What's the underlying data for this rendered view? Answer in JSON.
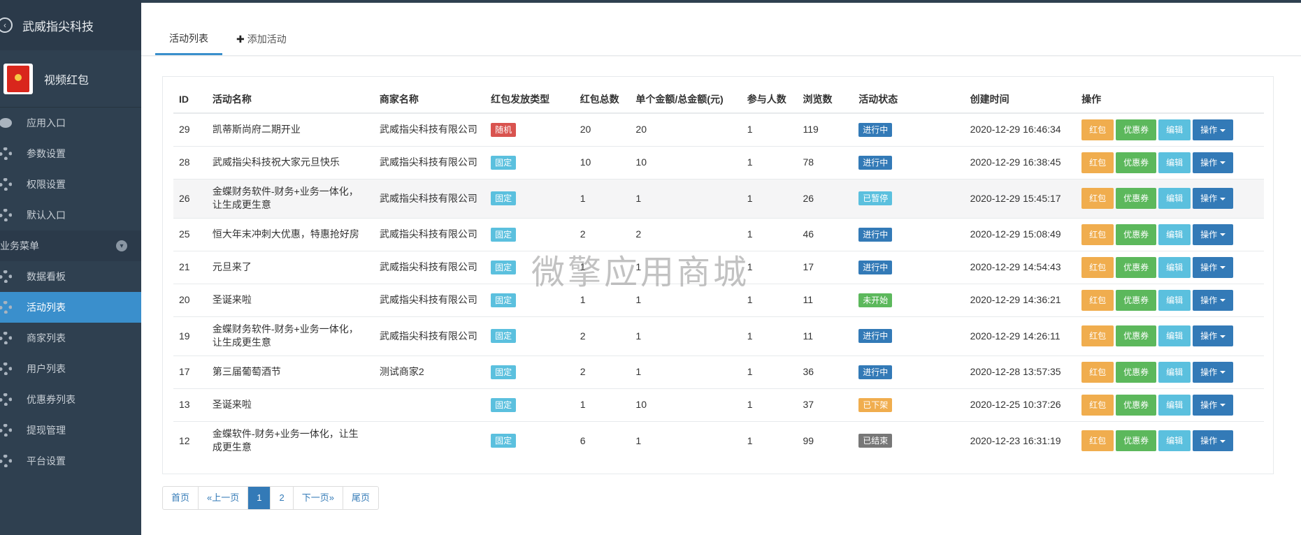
{
  "sidebar": {
    "company": "武威指尖科技",
    "app_name": "视频红包",
    "items_top": [
      {
        "label": "应用入口",
        "icon": "chat-icon"
      },
      {
        "label": "参数设置",
        "icon": "gear-icon"
      },
      {
        "label": "权限设置",
        "icon": "gear-icon"
      },
      {
        "label": "默认入口",
        "icon": "gear-icon"
      }
    ],
    "section_label": "业务菜单",
    "items": [
      {
        "label": "数据看板",
        "icon": "gear-icon",
        "active": false
      },
      {
        "label": "活动列表",
        "icon": "gear-icon",
        "active": true
      },
      {
        "label": "商家列表",
        "icon": "gear-icon",
        "active": false
      },
      {
        "label": "用户列表",
        "icon": "gear-icon",
        "active": false
      },
      {
        "label": "优惠券列表",
        "icon": "gear-icon",
        "active": false
      },
      {
        "label": "提现管理",
        "icon": "gear-icon",
        "active": false
      },
      {
        "label": "平台设置",
        "icon": "gear-icon",
        "active": false
      }
    ]
  },
  "tabs": {
    "list": "活动列表",
    "add": "添加活动"
  },
  "table": {
    "headers": [
      "ID",
      "活动名称",
      "商家名称",
      "红包发放类型",
      "红包总数",
      "单个金额/总金额(元)",
      "参与人数",
      "浏览数",
      "活动状态",
      "创建时间",
      "操作"
    ],
    "buttons": {
      "hongbao": "红包",
      "coupon": "优惠券",
      "edit": "编辑",
      "ops": "操作"
    },
    "rows": [
      {
        "id": "29",
        "name": "凯蒂斯尚府二期开业",
        "name2": "",
        "merchant": "武威指尖科技有限公司",
        "type": "随机",
        "total": "20",
        "amount": "20",
        "people": "1",
        "views": "119",
        "status": "进行中",
        "created": "2020-12-29 16:46:34"
      },
      {
        "id": "28",
        "name": "武威指尖科技祝大家元旦快乐",
        "name2": "",
        "merchant": "武威指尖科技有限公司",
        "type": "固定",
        "total": "10",
        "amount": "10",
        "people": "1",
        "views": "78",
        "status": "进行中",
        "created": "2020-12-29 16:38:45"
      },
      {
        "id": "26",
        "name": "金蝶财务软件-财务+业务一体化，",
        "name2": "让生成更生意",
        "merchant": "武威指尖科技有限公司",
        "type": "固定",
        "total": "1",
        "amount": "1",
        "people": "1",
        "views": "26",
        "status": "已暂停",
        "created": "2020-12-29 15:45:17"
      },
      {
        "id": "25",
        "name": "恒大年末冲刺大优惠，特惠抢好房",
        "name2": "",
        "merchant": "武威指尖科技有限公司",
        "type": "固定",
        "total": "2",
        "amount": "2",
        "people": "1",
        "views": "46",
        "status": "进行中",
        "created": "2020-12-29 15:08:49"
      },
      {
        "id": "21",
        "name": "元旦来了",
        "name2": "",
        "merchant": "武威指尖科技有限公司",
        "type": "固定",
        "total": "1",
        "amount": "1",
        "people": "1",
        "views": "17",
        "status": "进行中",
        "created": "2020-12-29 14:54:43"
      },
      {
        "id": "20",
        "name": "圣诞来啦",
        "name2": "",
        "merchant": "武威指尖科技有限公司",
        "type": "固定",
        "total": "1",
        "amount": "1",
        "people": "1",
        "views": "11",
        "status": "未开始",
        "created": "2020-12-29 14:36:21"
      },
      {
        "id": "19",
        "name": "金蝶财务软件-财务+业务一体化，",
        "name2": "让生成更生意",
        "merchant": "武威指尖科技有限公司",
        "type": "固定",
        "total": "2",
        "amount": "1",
        "people": "1",
        "views": "11",
        "status": "进行中",
        "created": "2020-12-29 14:26:11"
      },
      {
        "id": "17",
        "name": "第三届葡萄酒节",
        "name2": "",
        "merchant": "测试商家2",
        "type": "固定",
        "total": "2",
        "amount": "1",
        "people": "1",
        "views": "36",
        "status": "进行中",
        "created": "2020-12-28 13:57:35"
      },
      {
        "id": "13",
        "name": "圣诞来啦",
        "name2": "",
        "merchant": "",
        "type": "固定",
        "total": "1",
        "amount": "10",
        "people": "1",
        "views": "37",
        "status": "已下架",
        "created": "2020-12-25 10:37:26"
      },
      {
        "id": "12",
        "name": "金蝶软件-财务+业务一体化，让生",
        "name2": "成更生意",
        "merchant": "",
        "type": "固定",
        "total": "6",
        "amount": "1",
        "people": "1",
        "views": "99",
        "status": "已结束",
        "created": "2020-12-23 16:31:19"
      }
    ]
  },
  "pagination": {
    "first": "首页",
    "prev": "«上一页",
    "pages": [
      "1",
      "2"
    ],
    "current": "1",
    "next": "下一页»",
    "last": "尾页"
  },
  "watermark": "微擎应用商城",
  "colors": {
    "sidebar_bg": "#2f4050",
    "accent": "#3a8fcc",
    "btn_warning": "#f0ad4e",
    "btn_success": "#5cb85c",
    "btn_info": "#5bc0de",
    "btn_primary": "#337ab7"
  }
}
